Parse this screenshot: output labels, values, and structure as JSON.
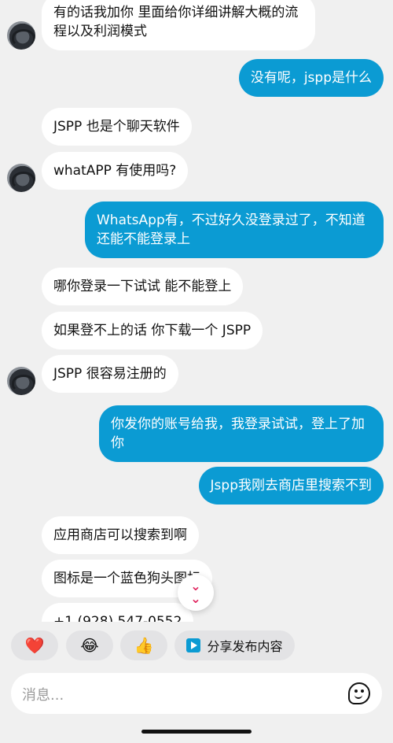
{
  "messages": [
    {
      "text": "有的话我加你 里面给你详细讲解大概的流程以及利润模式",
      "from": "in"
    },
    {
      "text": "没有呢，jspp是什么",
      "from": "out"
    },
    {
      "text": "JSPP 也是个聊天软件",
      "from": "in"
    },
    {
      "text": "whatAPP 有使用吗?",
      "from": "in"
    },
    {
      "text": "WhatsApp有，不过好久没登录过了，不知道还能不能登录上",
      "from": "out"
    },
    {
      "text": "哪你登录一下试试 能不能登上",
      "from": "in"
    },
    {
      "text": "如果登不上的话 你下载一个 JSPP",
      "from": "in"
    },
    {
      "text": "JSPP 很容易注册的",
      "from": "in"
    },
    {
      "text": "你发你的账号给我，我登录试试，登上了加你",
      "from": "out"
    },
    {
      "text": "Jspp我刚去商店里搜索不到",
      "from": "out"
    },
    {
      "text": "应用商店可以搜索到啊",
      "from": "in"
    },
    {
      "text": "图标是一个蓝色狗头图标",
      "from": "in"
    },
    {
      "text": "+1 (928) 547-0552",
      "from": "in"
    }
  ],
  "scroll_down_icon": "double-chevron-down-icon",
  "quick_reactions": [
    {
      "emoji": "❤️",
      "icon": "heart-icon"
    },
    {
      "emoji": "😂",
      "icon": "laughing-face-icon"
    },
    {
      "emoji": "👍",
      "icon": "thumbs-up-icon"
    }
  ],
  "share_chip": {
    "label": "分享发布内容",
    "icon": "play-icon"
  },
  "composer": {
    "placeholder": "消息...",
    "icon": "sticker-icon"
  },
  "colors": {
    "outgoing": "#0b9bd3",
    "incoming": "#ffffff",
    "background": "#f0f0f0"
  }
}
